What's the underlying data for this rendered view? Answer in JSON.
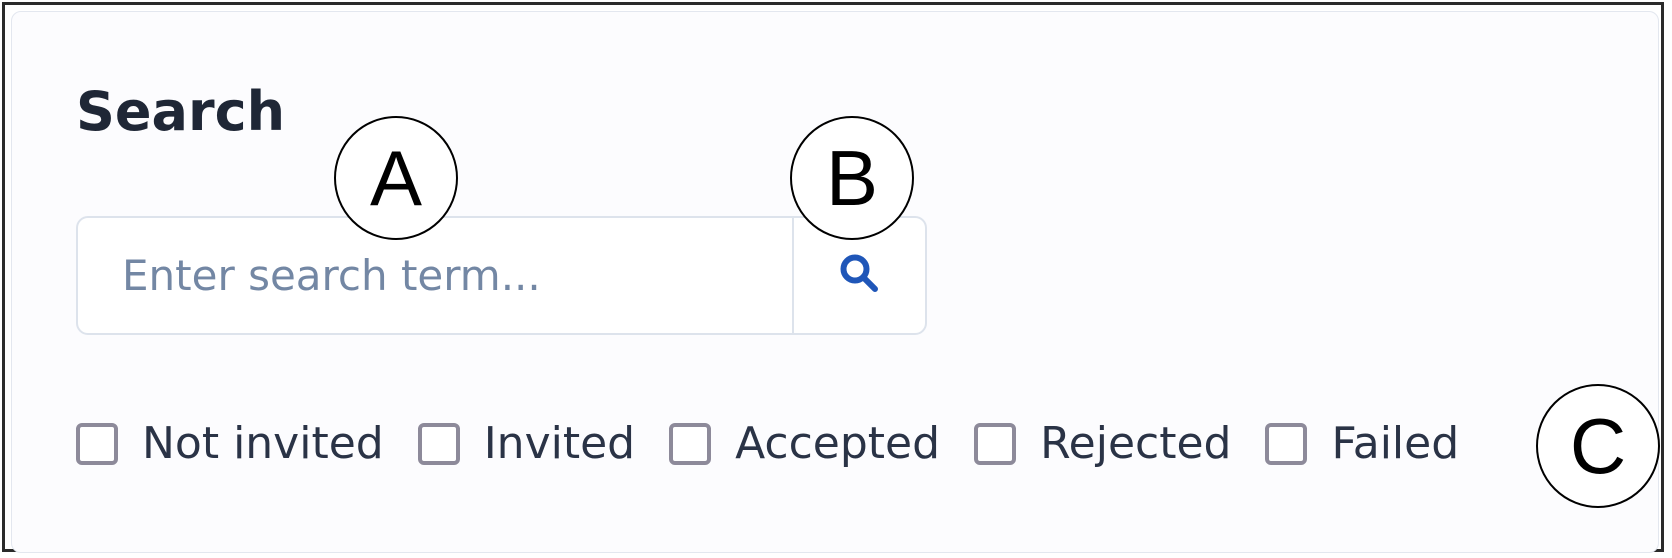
{
  "search": {
    "title": "Search",
    "placeholder": "Enter search term...",
    "value": "",
    "button_icon": "search-icon"
  },
  "filters": [
    {
      "label": "Not invited",
      "checked": false
    },
    {
      "label": "Invited",
      "checked": false
    },
    {
      "label": "Accepted",
      "checked": false
    },
    {
      "label": "Rejected",
      "checked": false
    },
    {
      "label": "Failed",
      "checked": false
    }
  ],
  "markers": {
    "a": "A",
    "b": "B",
    "c": "C"
  },
  "colors": {
    "title": "#1f2736",
    "placeholder": "#7387a4",
    "search_icon": "#1f56b8",
    "checkbox_border": "#8d8a9a",
    "input_border": "#dde3ec"
  }
}
